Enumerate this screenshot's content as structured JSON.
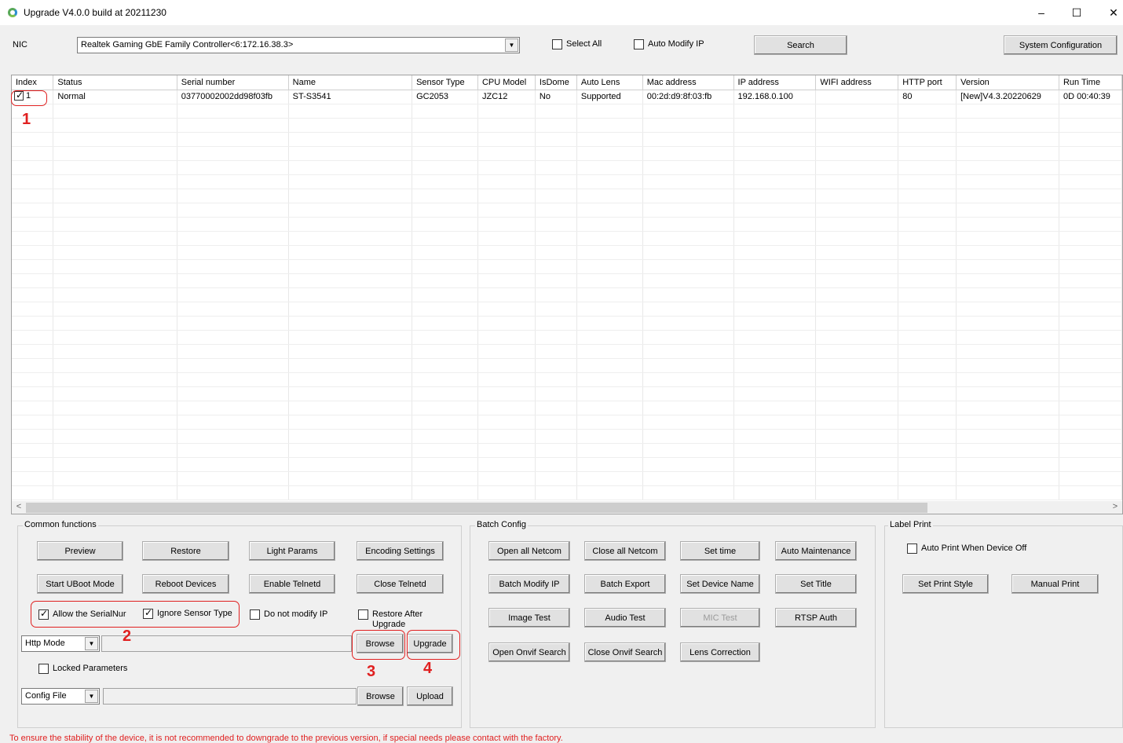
{
  "window": {
    "title": "Upgrade V4.0.0 build at 20211230",
    "minimize": "–",
    "maximize": "☐",
    "close": "✕"
  },
  "toolbar": {
    "nic_label": "NIC",
    "nic_value": "Realtek Gaming GbE Family Controller<6:172.16.38.3>",
    "select_all": "Select All",
    "auto_modify_ip": "Auto Modify IP",
    "search": "Search",
    "system_configuration": "System Configuration"
  },
  "table": {
    "columns": [
      "Index",
      "Status",
      "Serial number",
      "Name",
      "Sensor Type",
      "CPU Model",
      "IsDome",
      "Auto Lens",
      "Mac address",
      "IP address",
      "WIFI address",
      "HTTP port",
      "Version",
      "Run Time"
    ],
    "rows": [
      [
        "1",
        "Normal",
        "03770002002dd98f03fb",
        "ST-S3541",
        "GC2053",
        "JZC12",
        "No",
        "Supported",
        "00:2d:d9:8f:03:fb",
        "192.168.0.100",
        "",
        "80",
        "[New]V4.3.20220629",
        "0D 00:40:39"
      ]
    ]
  },
  "scrollbar": {
    "left": "<",
    "right": ">"
  },
  "common": {
    "title": "Common functions",
    "preview": "Preview",
    "restore": "Restore",
    "light_params": "Light Params",
    "encoding_settings": "Encoding Settings",
    "start_uboot": "Start UBoot Mode",
    "reboot": "Reboot Devices",
    "enable_telnetd": "Enable Telnetd",
    "close_telnetd": "Close Telnetd",
    "allow_serial": "Allow the SerialNur",
    "ignore_sensor": "Ignore Sensor Type",
    "no_modify_ip": "Do not modify IP",
    "restore_after": "Restore After Upgrade",
    "http_mode": "Http Mode",
    "browse": "Browse",
    "upgrade": "Upgrade",
    "locked_params": "Locked Parameters",
    "config_file": "Config File",
    "browse2": "Browse",
    "upload": "Upload"
  },
  "batch": {
    "title": "Batch Config",
    "open_netcom": "Open all Netcom",
    "close_netcom": "Close all Netcom",
    "set_time": "Set time",
    "auto_maint": "Auto Maintenance",
    "batch_modify_ip": "Batch Modify IP",
    "batch_export": "Batch Export",
    "set_device_name": "Set Device Name",
    "set_title": "Set Title",
    "image_test": "Image Test",
    "audio_test": "Audio Test",
    "mic_test": "MIC Test",
    "rtsp_auth": "RTSP Auth",
    "open_onvif": "Open Onvif Search",
    "close_onvif": "Close Onvif Search",
    "lens_correction": "Lens Correction"
  },
  "label_print": {
    "title": "Label Print",
    "auto_print": "Auto Print When Device Off",
    "set_style": "Set Print Style",
    "manual_print": "Manual Print"
  },
  "annotations": [
    "1",
    "2",
    "3",
    "4"
  ],
  "warning": "To ensure the stability of the device, it is not recommended to downgrade to the previous version, if special needs please contact with the factory."
}
